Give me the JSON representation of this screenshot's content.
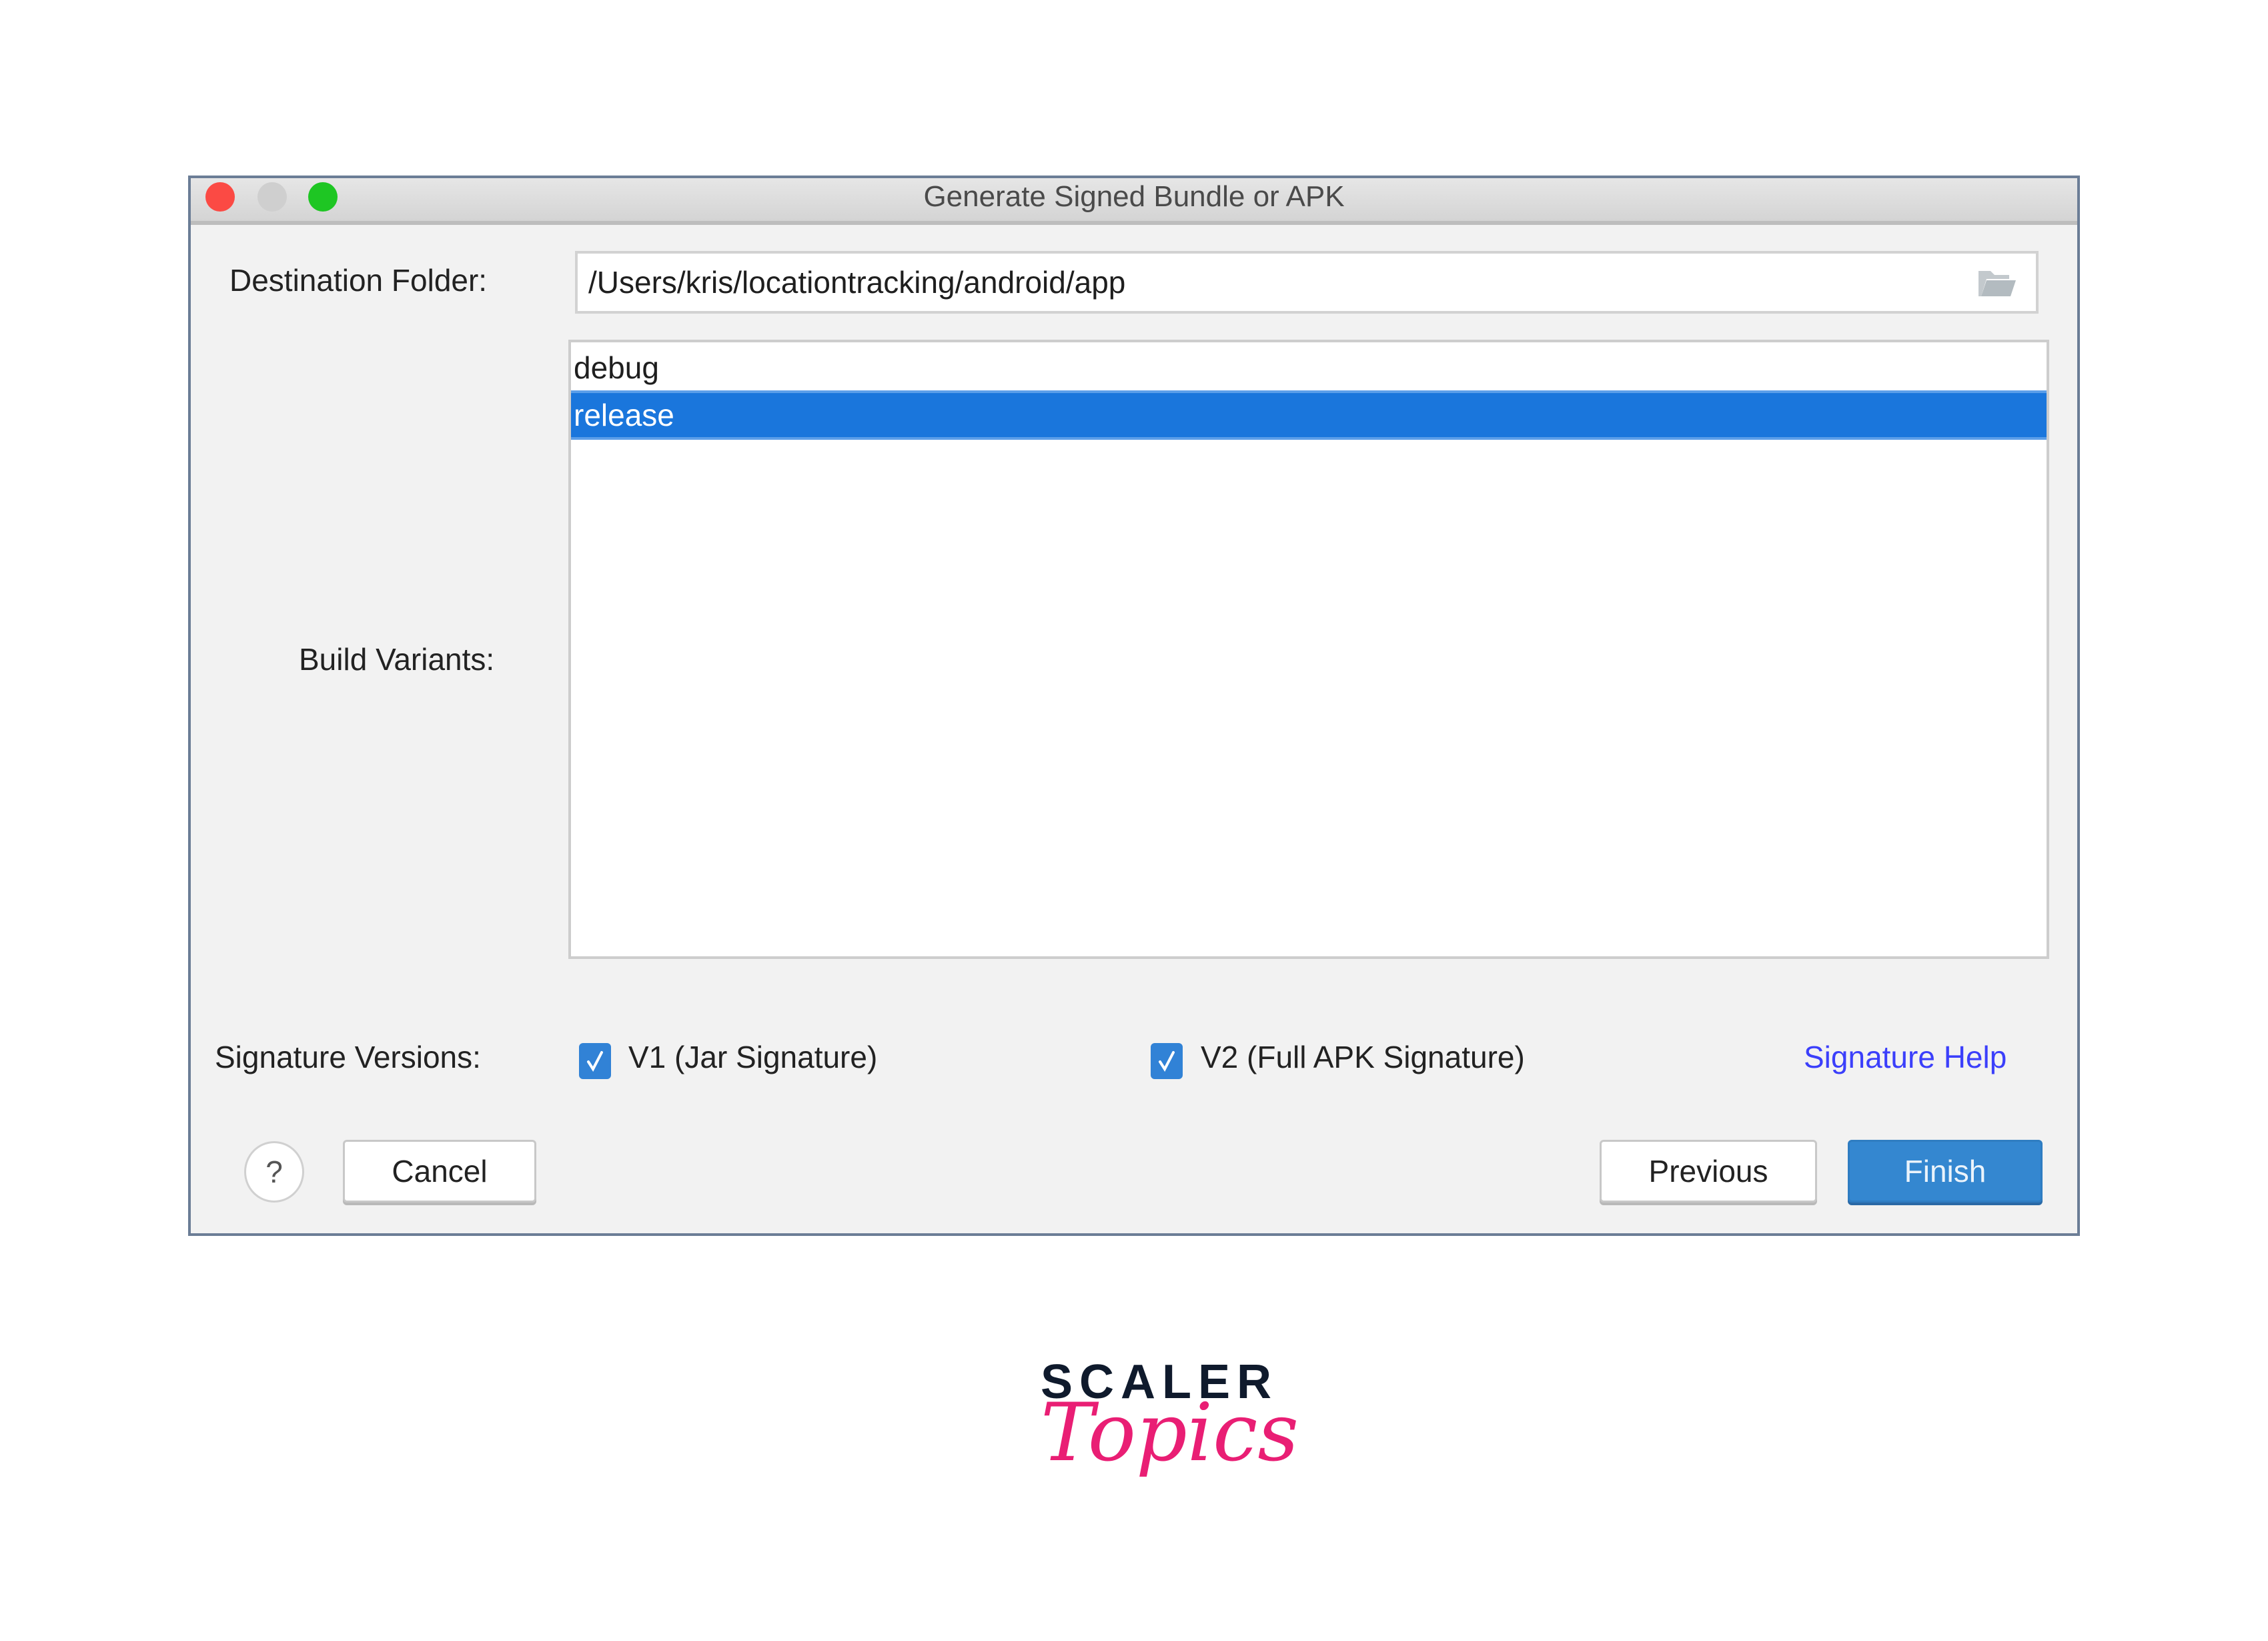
{
  "window": {
    "title": "Generate Signed Bundle or APK",
    "controls": [
      "close",
      "minimize",
      "maximize"
    ]
  },
  "form": {
    "destination_label": "Destination Folder:",
    "destination_value": "/Users/kris/locationtracking/android/app",
    "folder_icon": "folder-open-icon",
    "build_variants_label": "Build Variants:",
    "build_variants": [
      {
        "label": "debug",
        "selected": false
      },
      {
        "label": "release",
        "selected": true
      }
    ],
    "signature_label": "Signature Versions:",
    "signatures": [
      {
        "label": "V1 (Jar Signature)",
        "checked": true
      },
      {
        "label": "V2 (Full APK Signature)",
        "checked": true
      }
    ],
    "signature_help": "Signature Help"
  },
  "buttons": {
    "help": "?",
    "cancel": "Cancel",
    "previous": "Previous",
    "finish": "Finish"
  },
  "colors": {
    "selection": "#1a76dc",
    "primary_button": "#3487d0",
    "link": "#3b3ffb",
    "checkbox": "#3182d6"
  },
  "branding": {
    "line1": "SCALER",
    "line2": "Topics"
  }
}
